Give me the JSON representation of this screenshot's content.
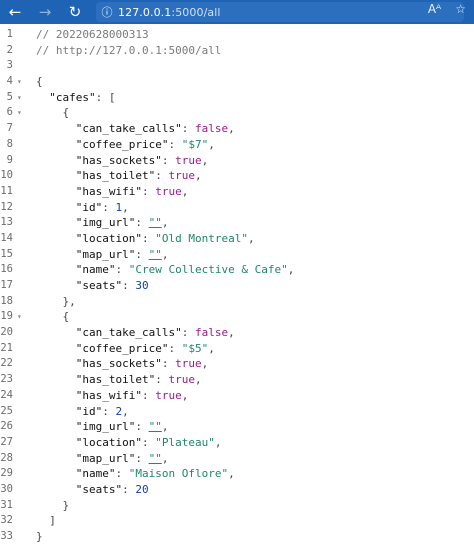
{
  "toolbar": {
    "back_icon": "←",
    "forward_icon": "→",
    "reload_icon": "↻",
    "info_icon": "ⓘ",
    "url_host": "127.0.0.1",
    "url_path": ":5000/all",
    "read_aloud_icon": "Aᴬ",
    "favorites_icon": "☆"
  },
  "lines": [
    {
      "num": "1",
      "text": "// 20220628000313"
    },
    {
      "num": "2",
      "text": "// http://127.0.0.1:5000/all"
    },
    {
      "num": "3",
      "text": ""
    },
    {
      "num": "4",
      "text": "{",
      "fold": "▾"
    },
    {
      "num": "5",
      "key": "cafes",
      "tail": "[",
      "indent": 1,
      "fold": "▾"
    },
    {
      "num": "6",
      "text": "{",
      "indent": 2,
      "fold": "▾"
    },
    {
      "num": "7",
      "key": "can_take_calls",
      "val": "false",
      "type": "b",
      "indent": 3
    },
    {
      "num": "8",
      "key": "coffee_price",
      "val": "\"$7\"",
      "type": "s",
      "indent": 3
    },
    {
      "num": "9",
      "key": "has_sockets",
      "val": "true",
      "type": "b",
      "indent": 3
    },
    {
      "num": "10",
      "key": "has_toilet",
      "val": "true",
      "type": "b",
      "indent": 3
    },
    {
      "num": "11",
      "key": "has_wifi",
      "val": "true",
      "type": "b",
      "indent": 3
    },
    {
      "num": "12",
      "key": "id",
      "val": "1",
      "type": "n",
      "indent": 3
    },
    {
      "num": "13",
      "key": "img_url",
      "val": "\"\"",
      "type": "e",
      "indent": 3
    },
    {
      "num": "14",
      "key": "location",
      "val": "\"Old Montreal\"",
      "type": "s",
      "indent": 3
    },
    {
      "num": "15",
      "key": "map_url",
      "val": "\"\"",
      "type": "e",
      "indent": 3
    },
    {
      "num": "16",
      "key": "name",
      "val": "\"Crew Collective & Cafe\"",
      "type": "s",
      "indent": 3
    },
    {
      "num": "17",
      "key": "seats",
      "val": "30",
      "type": "n",
      "indent": 3,
      "last": true
    },
    {
      "num": "18",
      "text": "},",
      "indent": 2
    },
    {
      "num": "19",
      "text": "{",
      "indent": 2,
      "fold": "▾"
    },
    {
      "num": "20",
      "key": "can_take_calls",
      "val": "false",
      "type": "b",
      "indent": 3
    },
    {
      "num": "21",
      "key": "coffee_price",
      "val": "\"$5\"",
      "type": "s",
      "indent": 3
    },
    {
      "num": "22",
      "key": "has_sockets",
      "val": "true",
      "type": "b",
      "indent": 3
    },
    {
      "num": "23",
      "key": "has_toilet",
      "val": "true",
      "type": "b",
      "indent": 3
    },
    {
      "num": "24",
      "key": "has_wifi",
      "val": "true",
      "type": "b",
      "indent": 3
    },
    {
      "num": "25",
      "key": "id",
      "val": "2",
      "type": "n",
      "indent": 3
    },
    {
      "num": "26",
      "key": "img_url",
      "val": "\"\"",
      "type": "e",
      "indent": 3
    },
    {
      "num": "27",
      "key": "location",
      "val": "\"Plateau\"",
      "type": "s",
      "indent": 3
    },
    {
      "num": "28",
      "key": "map_url",
      "val": "\"\"",
      "type": "e",
      "indent": 3
    },
    {
      "num": "29",
      "key": "name",
      "val": "\"Maison Oflore\"",
      "type": "s",
      "indent": 3
    },
    {
      "num": "30",
      "key": "seats",
      "val": "20",
      "type": "n",
      "indent": 3,
      "last": true
    },
    {
      "num": "31",
      "text": "}",
      "indent": 2
    },
    {
      "num": "32",
      "text": "]",
      "indent": 1
    },
    {
      "num": "33",
      "text": "}"
    }
  ]
}
